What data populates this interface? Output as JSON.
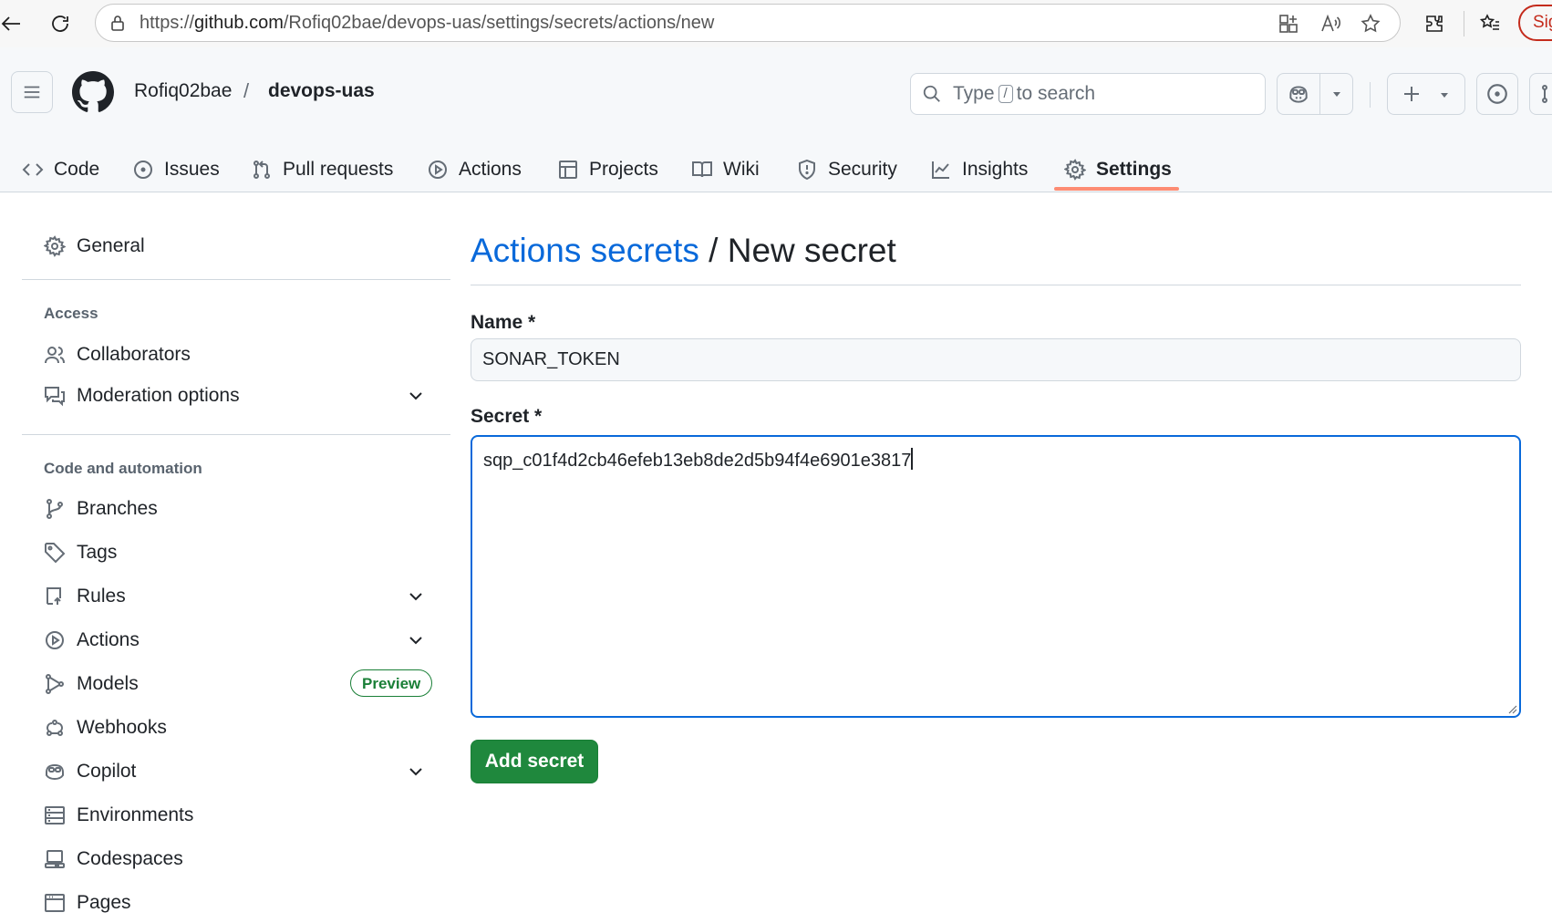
{
  "browser": {
    "url_prefix": "https://",
    "url_host": "github.com",
    "url_path": "/Rofiq02bae/devops-uas/settings/secrets/actions/new",
    "sign_in_label": "Sig"
  },
  "header": {
    "owner": "Rofiq02bae",
    "separator": "/",
    "repo": "devops-uas",
    "search": {
      "before": "Type",
      "key": "/",
      "after": "to search"
    }
  },
  "repo_nav": {
    "tabs": [
      {
        "label": "Code",
        "icon": "code-icon"
      },
      {
        "label": "Issues",
        "icon": "issue-opened-icon"
      },
      {
        "label": "Pull requests",
        "icon": "git-pull-request-icon"
      },
      {
        "label": "Actions",
        "icon": "play-icon"
      },
      {
        "label": "Projects",
        "icon": "table-icon"
      },
      {
        "label": "Wiki",
        "icon": "book-icon"
      },
      {
        "label": "Security",
        "icon": "shield-icon"
      },
      {
        "label": "Insights",
        "icon": "graph-icon"
      },
      {
        "label": "Settings",
        "icon": "gear-icon",
        "selected": true
      }
    ]
  },
  "sidebar": {
    "general": "General",
    "access_heading": "Access",
    "access_items": [
      {
        "label": "Collaborators",
        "icon": "people-icon"
      },
      {
        "label": "Moderation options",
        "icon": "comment-discussion-icon",
        "expandable": true
      }
    ],
    "code_heading": "Code and automation",
    "code_items": [
      {
        "label": "Branches",
        "icon": "git-branch-icon"
      },
      {
        "label": "Tags",
        "icon": "tag-icon"
      },
      {
        "label": "Rules",
        "icon": "repo-push-icon",
        "expandable": true
      },
      {
        "label": "Actions",
        "icon": "play-icon",
        "expandable": true
      },
      {
        "label": "Models",
        "icon": "models-icon",
        "badge": "Preview"
      },
      {
        "label": "Webhooks",
        "icon": "webhook-icon"
      },
      {
        "label": "Copilot",
        "icon": "copilot-icon",
        "expandable": true
      },
      {
        "label": "Environments",
        "icon": "server-icon"
      },
      {
        "label": "Codespaces",
        "icon": "codespaces-icon"
      },
      {
        "label": "Pages",
        "icon": "browser-icon"
      }
    ]
  },
  "main": {
    "breadcrumb_link": "Actions secrets",
    "breadcrumb_sep": " / ",
    "title": "New secret",
    "name_label": "Name *",
    "name_value": "SONAR_TOKEN",
    "secret_label": "Secret *",
    "secret_value": "sqp_c01f4d2cb46efeb13eb8de2d5b94f4e6901e3817",
    "submit_label": "Add secret"
  },
  "colors": {
    "accent_link": "#0969da",
    "primary_button": "#1f883d",
    "selected_tab_underline": "#fd8c73",
    "badge_green": "#1a7f37"
  }
}
